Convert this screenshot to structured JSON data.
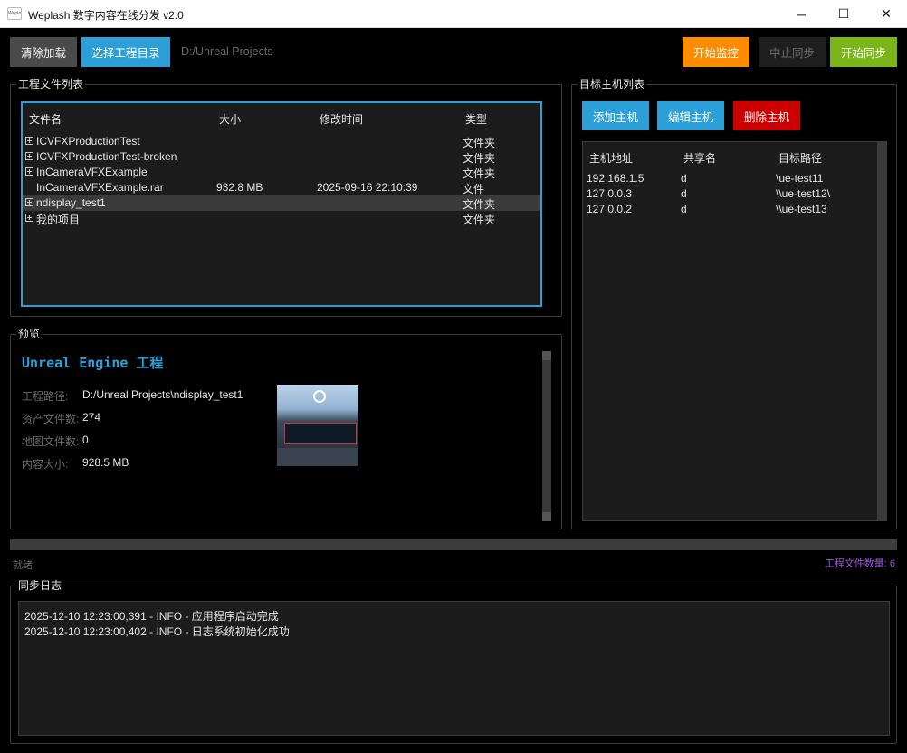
{
  "window": {
    "title": "Weplash 数字内容在线分发 v2.0",
    "icon_text": "Weplash",
    "minimize_glyph": "─",
    "maximize_glyph": "☐",
    "close_glyph": "✕"
  },
  "toolbar": {
    "clear_label": "清除加载",
    "select_label": "选择工程目录",
    "current_path": "D:/Unreal Projects",
    "monitor_label": "开始监控",
    "stop_label": "中止同步",
    "start_label": "开始同步"
  },
  "files": {
    "group_title": "工程文件列表",
    "columns": [
      "文件名",
      "大小",
      "修改时间",
      "类型"
    ],
    "rows": [
      {
        "name": "ICVFXProductionTest",
        "size": "",
        "modified": "",
        "type": "文件夹",
        "expandable": true
      },
      {
        "name": "ICVFXProductionTest-broken",
        "size": "",
        "modified": "",
        "type": "文件夹",
        "expandable": true
      },
      {
        "name": "InCameraVFXExample",
        "size": "",
        "modified": "",
        "type": "文件夹",
        "expandable": true
      },
      {
        "name": "InCameraVFXExample.rar",
        "size": "932.8 MB",
        "modified": "2025-09-16 22:10:39",
        "type": "文件",
        "expandable": false
      },
      {
        "name": "ndisplay_test1",
        "size": "",
        "modified": "",
        "type": "文件夹",
        "expandable": true,
        "selected": true
      },
      {
        "name": "我的项目",
        "size": "",
        "modified": "",
        "type": "文件夹",
        "expandable": true
      }
    ]
  },
  "preview": {
    "group_title": "预览",
    "heading": "Unreal Engine 工程",
    "fields": [
      {
        "label": "工程路径:",
        "value": "D:/Unreal Projects\\ndisplay_test1"
      },
      {
        "label": "资产文件数:",
        "value": "274"
      },
      {
        "label": "地图文件数:",
        "value": "0"
      },
      {
        "label": "内容大小:",
        "value": "928.5 MB"
      }
    ]
  },
  "hosts": {
    "group_title": "目标主机列表",
    "add_label": "添加主机",
    "edit_label": "编辑主机",
    "delete_label": "删除主机",
    "columns": [
      "主机地址",
      "共享名",
      "目标路径"
    ],
    "rows": [
      {
        "address": "192.168.1.5",
        "share": "d",
        "path": "\\ue-test11"
      },
      {
        "address": "127.0.0.3",
        "share": "d",
        "path": "\\\\ue-test12\\"
      },
      {
        "address": "127.0.0.2",
        "share": "d",
        "path": "\\\\ue-test13"
      }
    ]
  },
  "status": {
    "left_text": "就绪",
    "right_text": "工程文件数量: 6",
    "progress": 0
  },
  "log": {
    "group_title": "同步日志",
    "lines": [
      "2025-12-10 12:23:00,391 - INFO - 应用程序启动完成",
      "2025-12-10 12:23:00,402 - INFO - 日志系统初始化成功"
    ]
  },
  "colors": {
    "accent_blue": "#2d9fd8",
    "monitor_orange": "#ff8c00",
    "start_green": "#7cb518",
    "delete_red": "#cc0000",
    "count_purple": "#a155e6"
  }
}
